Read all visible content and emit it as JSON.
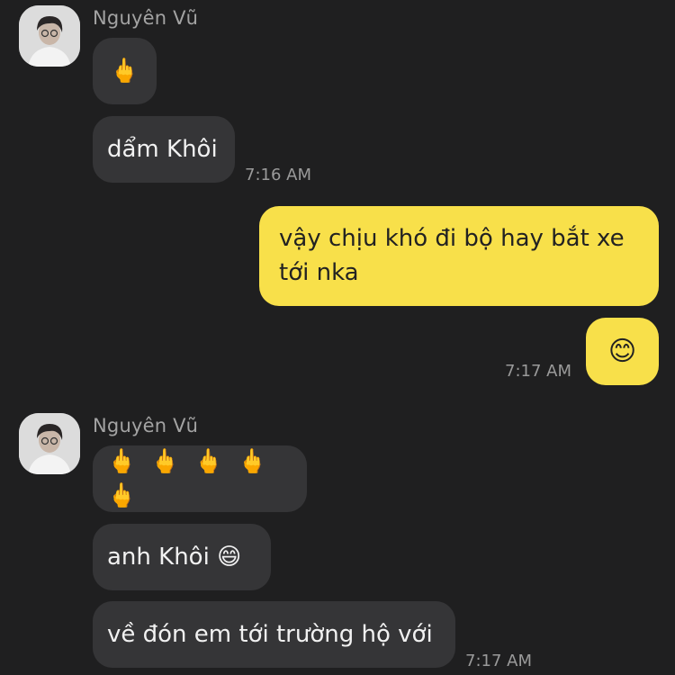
{
  "colors": {
    "background": "#1f1f20",
    "incoming_bubble": "#353537",
    "outgoing_bubble": "#f8e04a",
    "sender_name": "#a3a3a3",
    "timestamp": "#9a9a9a"
  },
  "groups": [
    {
      "sender": "Nguyên Vũ",
      "messages": [
        {
          "text": "🖕",
          "icon": "middle-finger-emoji"
        },
        {
          "text": "dẩm Khôi"
        }
      ],
      "time": "7:16 AM"
    },
    {
      "sender": "me",
      "messages": [
        {
          "text": "vậy chịu khó đi bộ hay bắt xe tới nka"
        },
        {
          "text": "😊",
          "icon": "smiling-face-emoji"
        }
      ],
      "time": "7:17 AM"
    },
    {
      "sender": "Nguyên Vũ",
      "messages": [
        {
          "text": "🖕🖕🖕🖕🖕",
          "icon": "middle-finger-emoji"
        },
        {
          "text": "anh Khôi 😄"
        },
        {
          "text": "về đón em tới trường hộ với"
        }
      ],
      "time": "7:17 AM"
    }
  ]
}
